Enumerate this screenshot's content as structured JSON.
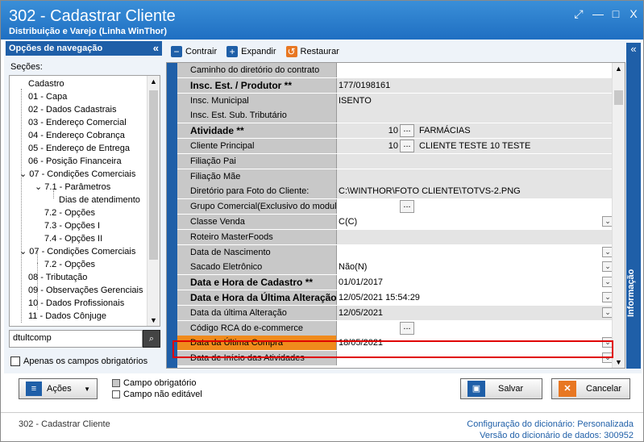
{
  "window": {
    "title": "302 - Cadastrar Cliente",
    "subtitle": "Distribuição e Varejo (Linha WinThor)",
    "maximize_icon": "□",
    "close_icon": "X",
    "restore_icon": "⤢",
    "minimize_icon": "—"
  },
  "nav": {
    "title": "Opções de navegação",
    "collapse_icon": "«",
    "sections_label": "Seções:",
    "items": [
      {
        "label": "Cadastro"
      },
      {
        "label": "01 - Capa"
      },
      {
        "label": "02 - Dados Cadastrais"
      },
      {
        "label": "03 - Endereço Comercial"
      },
      {
        "label": "04 - Endereço Cobrança"
      },
      {
        "label": "05 - Endereço de Entrega"
      },
      {
        "label": "06 - Posição Financeira"
      },
      {
        "label": "07 - Condições Comerciais"
      },
      {
        "label": "7.1 - Parâmetros"
      },
      {
        "label": "Dias de atendimento"
      },
      {
        "label": "7.2 - Opções"
      },
      {
        "label": "7.3 - Opções I"
      },
      {
        "label": "7.4 - Opções II"
      },
      {
        "label": "07 - Condições Comerciais"
      },
      {
        "label": "7.2 - Opções"
      },
      {
        "label": "08 - Tributação"
      },
      {
        "label": "09 - Observações Gerenciais"
      },
      {
        "label": "10 - Dados Profissionais"
      },
      {
        "label": "11 - Dados Cônjuge"
      }
    ],
    "search_value": "dtultcomp",
    "required_only_label": "Apenas os campos obrigatórios"
  },
  "toolbar": {
    "collapse": "Contrair",
    "expand": "Expandir",
    "restore": "Restaurar"
  },
  "grid": {
    "rows": [
      {
        "label": "Caminho do diretório do contrato",
        "value": ""
      },
      {
        "label": "Insc. Est. / Produtor **",
        "value": "177/0198161"
      },
      {
        "label": "Insc. Municipal",
        "value": "ISENTO"
      },
      {
        "label": "Insc. Est. Sub. Tributário",
        "value": ""
      },
      {
        "label": "Atividade **",
        "num": "10",
        "desc": "FARMÁCIAS"
      },
      {
        "label": "Cliente Principal",
        "num": "10",
        "desc": "CLIENTE TESTE 10 TESTE"
      },
      {
        "label": "Filiação Pai",
        "value": ""
      },
      {
        "label": "Filiação Mãe",
        "value": ""
      },
      {
        "label": "Diretório para Foto do Cliente:",
        "value": "C:\\WINTHOR\\FOTO CLIENTE\\TOTVS-2.PNG"
      },
      {
        "label": "Grupo Comercial(Exclusivo do modulo",
        "value": ""
      },
      {
        "label": "Classe Venda",
        "value": "C(C)"
      },
      {
        "label": "Roteiro MasterFoods",
        "value": ""
      },
      {
        "label": "Data de Nascimento",
        "value": ""
      },
      {
        "label": "Sacado Eletrônico",
        "value": "Não(N)"
      },
      {
        "label": "Data e Hora de Cadastro **",
        "value": "01/01/2017"
      },
      {
        "label": "Data e Hora da Última Alteração",
        "value": "12/05/2021 15:54:29"
      },
      {
        "label": "Data da última Alteração",
        "value": "12/05/2021"
      },
      {
        "label": "Código RCA do e-commerce",
        "value": ""
      },
      {
        "label": "Data da Última Compra",
        "value": "18/05/2021"
      },
      {
        "label": "Data de Início das Atividades",
        "value": ""
      }
    ]
  },
  "info_label": "Informação",
  "buttons": {
    "actions": "Ações",
    "save": "Salvar",
    "cancel": "Cancelar"
  },
  "legend": {
    "required": "Campo obrigatório",
    "readonly": "Campo não editável"
  },
  "status": {
    "screen": "302 - Cadastrar Cliente",
    "config_label": "Configuração do dicionário:",
    "config_value": "Personalizada",
    "version_label": "Versão do dicionário de dados:",
    "version_value": "300952"
  }
}
